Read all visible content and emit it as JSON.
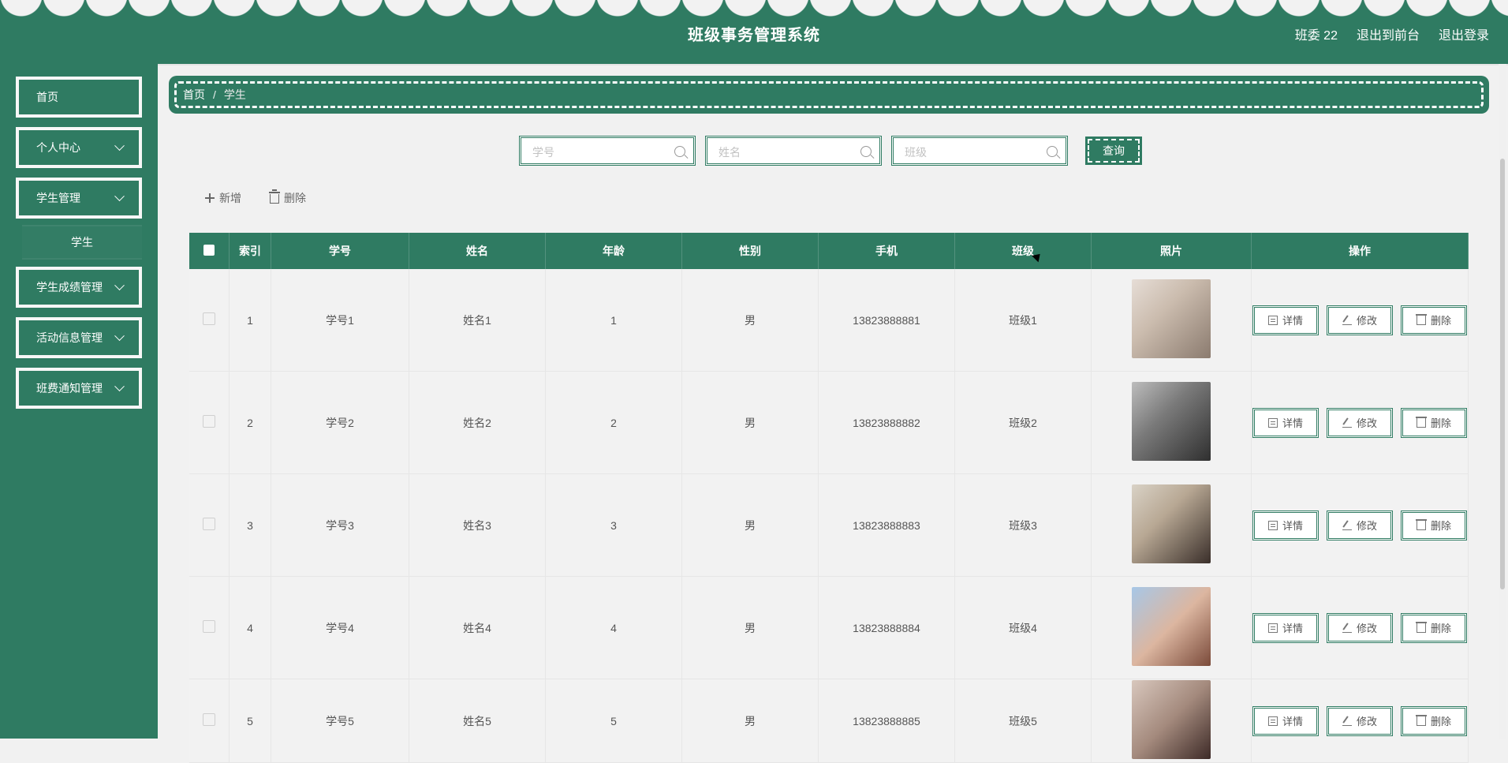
{
  "header": {
    "title": "班级事务管理系统",
    "user": "班委 22",
    "to_front_label": "退出到前台",
    "logout_label": "退出登录"
  },
  "sidebar": {
    "items": [
      {
        "label": "首页"
      },
      {
        "label": "个人中心"
      },
      {
        "label": "学生管理"
      },
      {
        "label": "学生成绩管理"
      },
      {
        "label": "活动信息管理"
      },
      {
        "label": "班费通知管理"
      }
    ],
    "submenu_selected": "学生"
  },
  "breadcrumb": {
    "home": "首页",
    "sep": "/",
    "current": "学生"
  },
  "search": {
    "student_id_placeholder": "学号",
    "name_placeholder": "姓名",
    "class_placeholder": "班级",
    "query_label": "查询"
  },
  "actions": {
    "add_label": "新增",
    "delete_label": "删除"
  },
  "table": {
    "headers": [
      "索引",
      "学号",
      "姓名",
      "年龄",
      "性别",
      "手机",
      "班级",
      "照片",
      "操作"
    ],
    "rows": [
      {
        "index": "1",
        "student_id": "学号1",
        "name": "姓名1",
        "age": "1",
        "gender": "男",
        "phone": "13823888881",
        "class": "班级1"
      },
      {
        "index": "2",
        "student_id": "学号2",
        "name": "姓名2",
        "age": "2",
        "gender": "男",
        "phone": "13823888882",
        "class": "班级2"
      },
      {
        "index": "3",
        "student_id": "学号3",
        "name": "姓名3",
        "age": "3",
        "gender": "男",
        "phone": "13823888883",
        "class": "班级3"
      },
      {
        "index": "4",
        "student_id": "学号4",
        "name": "姓名4",
        "age": "4",
        "gender": "男",
        "phone": "13823888884",
        "class": "班级4"
      },
      {
        "index": "5",
        "student_id": "学号5",
        "name": "姓名5",
        "age": "5",
        "gender": "男",
        "phone": "13823888885",
        "class": "班级5"
      }
    ],
    "ops": {
      "detail": "详情",
      "edit": "修改",
      "delete": "删除"
    }
  },
  "colors": {
    "accent": "#2f7b62"
  }
}
